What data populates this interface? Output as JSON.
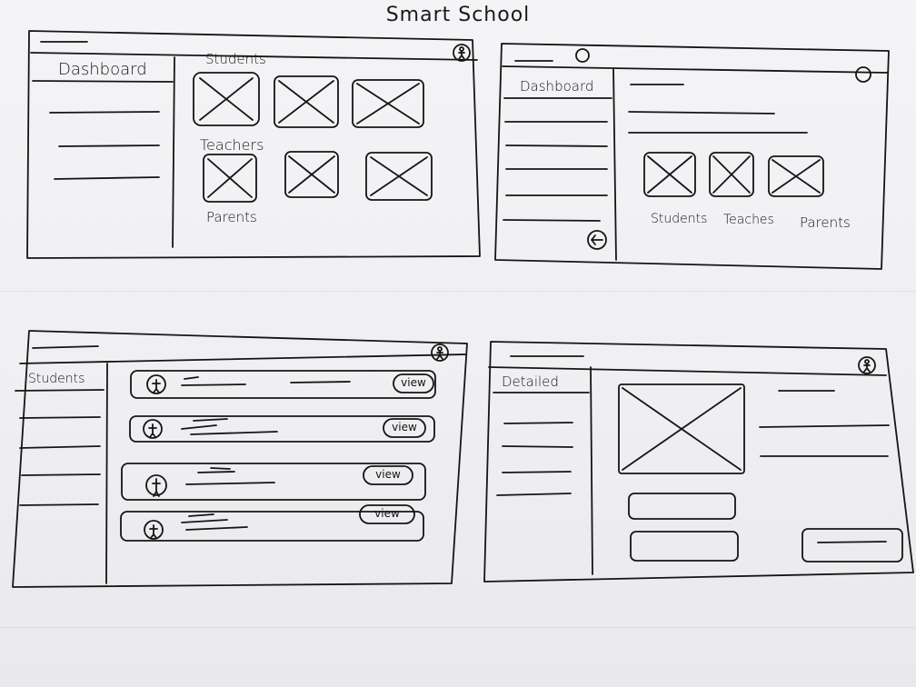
{
  "title": "Smart School",
  "panel_dashboard_main": {
    "sidebar_heading": "Dashboard",
    "section_students": "Students",
    "section_teachers": "Teachers",
    "section_parents": "Parents"
  },
  "panel_dashboard_alt": {
    "sidebar_heading": "Dashboard",
    "card_students": "Students",
    "card_teachers": "Teaches",
    "card_parents": "Parents"
  },
  "panel_students_list": {
    "sidebar_heading": "Students",
    "rows": [
      {
        "action": "view"
      },
      {
        "action": "view"
      },
      {
        "action": "view"
      },
      {
        "action": "view"
      }
    ]
  },
  "panel_detailed": {
    "sidebar_heading": "Detailed"
  },
  "colors": {
    "ink": "#151515",
    "paper": "#f2f2f4"
  },
  "icons": [
    "user-icon",
    "back-arrow-icon",
    "image-placeholder-icon",
    "window-circle-icon"
  ]
}
